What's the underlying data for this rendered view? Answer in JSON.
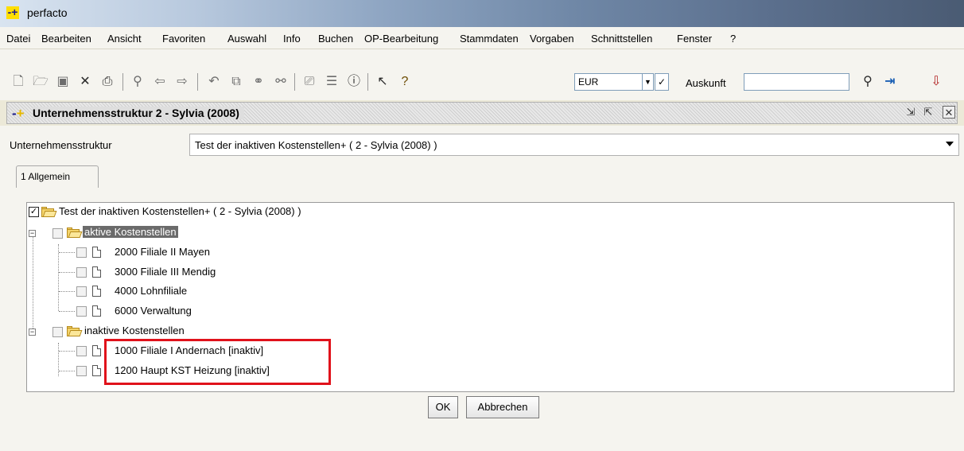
{
  "app": {
    "title": "perfacto"
  },
  "menu": [
    "Datei",
    "Bearbeiten",
    "Ansicht",
    "Favoriten",
    "Auswahl",
    "Info",
    "Buchen",
    "OP-Bearbeitung",
    "Stammdaten",
    "Vorgaben",
    "Schnittstellen",
    "Fenster",
    "?"
  ],
  "toolbar": {
    "currency": "EUR",
    "auskunft_label": "Auskunft",
    "auskunft_value": ""
  },
  "window": {
    "title": "Unternehmensstruktur  2 - Sylvia (2008)"
  },
  "form": {
    "structure_label": "Unternehmensstruktur",
    "structure_value": "Test der inaktiven Kostenstellen+ ( 2 - Sylvia (2008) )"
  },
  "tabs": [
    {
      "label": "1 Allgemein"
    }
  ],
  "tree": {
    "root": {
      "label": "Test der inaktiven Kostenstellen+ ( 2 - Sylvia (2008) )",
      "checked": true
    },
    "groups": [
      {
        "label": "aktive Kostenstellen",
        "expanded": true,
        "selected": true,
        "items": [
          "2000 Filiale II  Mayen",
          "3000 Filiale III  Mendig",
          "4000 Lohnfiliale",
          "6000 Verwaltung"
        ]
      },
      {
        "label": "inaktive Kostenstellen",
        "expanded": true,
        "selected": false,
        "items": [
          "1000 Filiale I  Andernach [inaktiv]",
          "1200 Haupt KST Heizung [inaktiv]"
        ]
      }
    ]
  },
  "buttons": {
    "ok": "OK",
    "cancel": "Abbrechen"
  },
  "colors": {
    "highlight_box": "#e0121b",
    "selection": "#6b6b6b"
  }
}
